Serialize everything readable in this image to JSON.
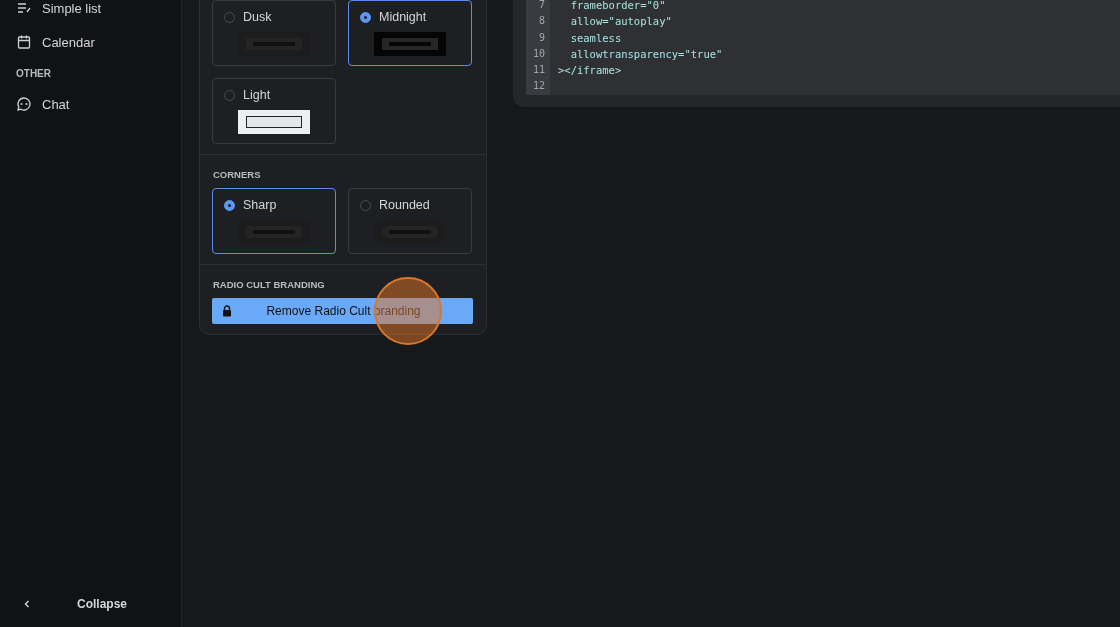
{
  "sidebar": {
    "items": [
      {
        "kind": "list",
        "label": "Simple list"
      },
      {
        "kind": "calendar",
        "label": "Calendar"
      }
    ],
    "sections": [
      {
        "heading": "OTHER",
        "items": [
          {
            "kind": "chat",
            "label": "Chat"
          }
        ]
      }
    ],
    "collapse": {
      "label": "Collapse"
    }
  },
  "appearance": {
    "themes": [
      {
        "kind": "dusk",
        "label": "Dusk",
        "selected": false
      },
      {
        "kind": "midnight",
        "label": "Midnight",
        "selected": true
      },
      {
        "kind": "light",
        "label": "Light",
        "selected": false
      }
    ],
    "corners": {
      "heading": "CORNERS",
      "options": [
        {
          "kind": "sharp",
          "label": "Sharp",
          "selected": true
        },
        {
          "kind": "rounded",
          "label": "Rounded",
          "selected": false
        }
      ]
    },
    "branding": {
      "heading": "RADIO CULT BRANDING",
      "button": "Remove Radio Cult branding"
    }
  },
  "code": {
    "lines": [
      {
        "number": "7",
        "text": "  frameborder=\"0\""
      },
      {
        "number": "8",
        "text": "  allow=\"autoplay\""
      },
      {
        "number": "9",
        "text": "  seamless"
      },
      {
        "number": "10",
        "text": "  allowtransparency=\"true\""
      },
      {
        "number": "11",
        "text": "></iframe>"
      },
      {
        "number": "12"
      }
    ]
  }
}
